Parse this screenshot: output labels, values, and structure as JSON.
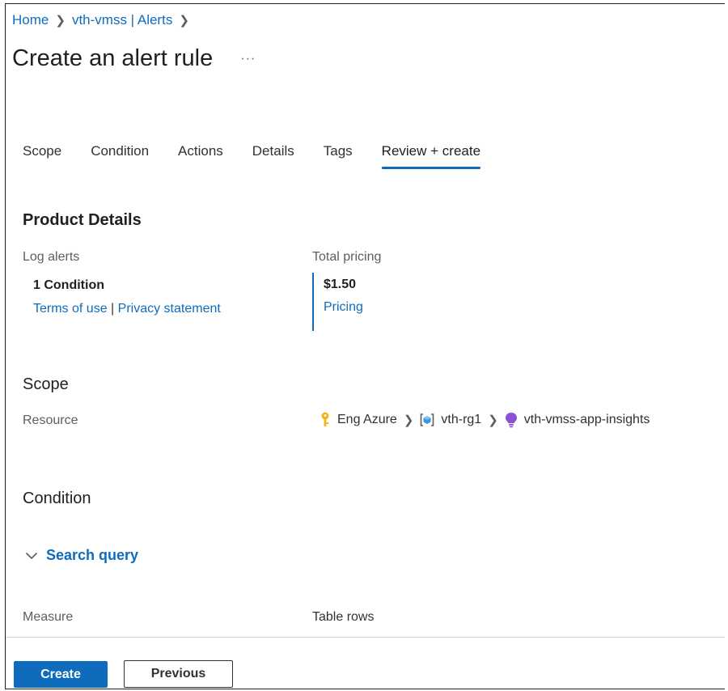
{
  "breadcrumb": {
    "home": "Home",
    "resource": "vth-vmss | Alerts"
  },
  "page": {
    "title": "Create an alert rule",
    "more": "···"
  },
  "tabs": [
    {
      "label": "Scope"
    },
    {
      "label": "Condition"
    },
    {
      "label": "Actions"
    },
    {
      "label": "Details"
    },
    {
      "label": "Tags"
    },
    {
      "label": "Review + create",
      "active": true
    }
  ],
  "product_details": {
    "title": "Product Details",
    "log_alerts_label": "Log alerts",
    "condition_count": "1 Condition",
    "terms_link": "Terms of use",
    "separator": "|",
    "privacy_link": "Privacy statement",
    "total_pricing_label": "Total pricing",
    "price": "$1.50",
    "pricing_link": "Pricing"
  },
  "scope": {
    "title": "Scope",
    "resource_label": "Resource",
    "path": [
      {
        "label": "Eng Azure",
        "icon": "key-icon"
      },
      {
        "label": "vth-rg1",
        "icon": "resource-group-icon"
      },
      {
        "label": "vth-vmss-app-insights",
        "icon": "app-insights-icon"
      }
    ]
  },
  "condition": {
    "title": "Condition",
    "expander_label": "Search query",
    "measure_label": "Measure",
    "measure_value": "Table rows"
  },
  "footer": {
    "create_label": "Create",
    "previous_label": "Previous"
  },
  "colors": {
    "accent": "#0f6cbd",
    "key_icon": "#f2b418",
    "app_insights_icon": "#8a52d6",
    "resource_group_icon": "#3a96dd"
  }
}
